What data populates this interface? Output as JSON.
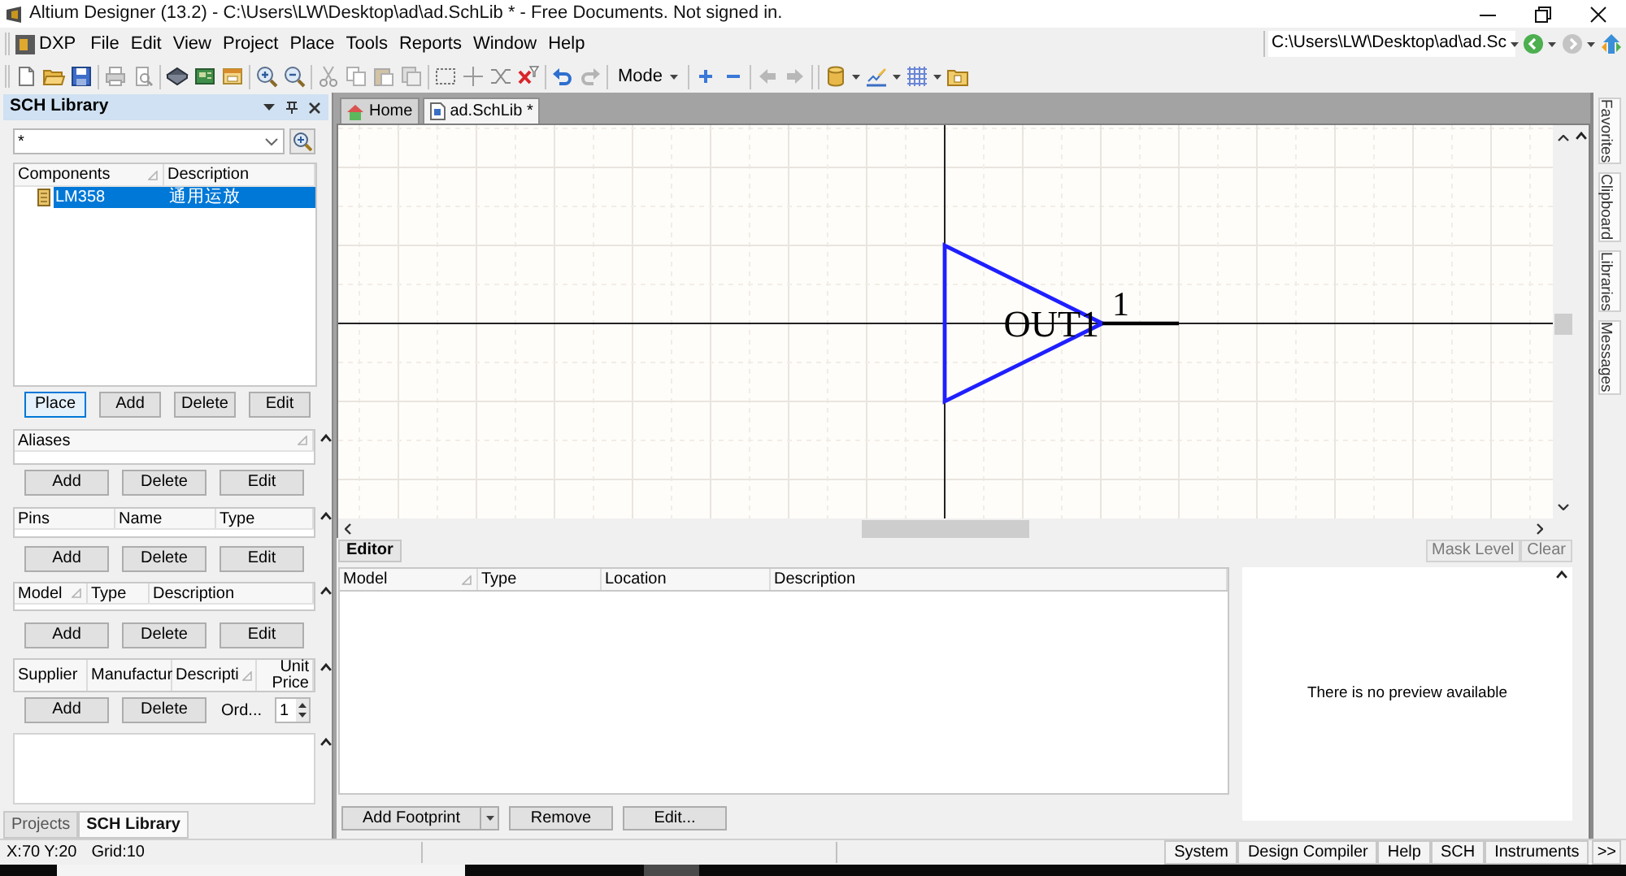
{
  "window": {
    "title": "Altium Designer (13.2) - C:\\Users\\LW\\Desktop\\ad\\ad.SchLib * - Free Documents. Not signed in."
  },
  "menu": {
    "app_button": "DXP",
    "items": [
      "File",
      "Edit",
      "View",
      "Project",
      "Place",
      "Tools",
      "Reports",
      "Window",
      "Help"
    ],
    "path": "C:\\Users\\LW\\Desktop\\ad\\ad.Sc"
  },
  "toolbar": {
    "mode": "Mode"
  },
  "left_panel": {
    "title": "SCH Library",
    "filter": {
      "value": "*"
    },
    "components": {
      "columns": [
        {
          "label": "Components",
          "sorted": true
        },
        {
          "label": "Description",
          "sorted": false
        }
      ],
      "rows": [
        {
          "name": "LM358",
          "description": "通用运放",
          "selected": true
        }
      ],
      "buttons": [
        {
          "label": "Place",
          "focused": true
        },
        {
          "label": "Add",
          "focused": false
        },
        {
          "label": "Delete",
          "focused": false
        },
        {
          "label": "Edit",
          "focused": false
        }
      ]
    },
    "aliases": {
      "columns": [
        {
          "label": "Aliases",
          "sorted": true
        }
      ],
      "buttons": [
        "Add",
        "Delete",
        "Edit"
      ]
    },
    "pins": {
      "columns": [
        {
          "label": "Pins",
          "sorted": false
        },
        {
          "label": "Name",
          "sorted": false
        },
        {
          "label": "Type",
          "sorted": false
        }
      ],
      "buttons": [
        "Add",
        "Delete",
        "Edit"
      ]
    },
    "models": {
      "columns": [
        {
          "label": "Model",
          "sorted": true
        },
        {
          "label": "Type",
          "sorted": false
        },
        {
          "label": "Description",
          "sorted": false
        }
      ],
      "buttons": [
        "Add",
        "Delete",
        "Edit"
      ]
    },
    "suppliers": {
      "columns": [
        {
          "label": "Supplier",
          "sorted": false
        },
        {
          "label": "Manufactur",
          "sorted": false
        },
        {
          "label": "Descripti",
          "sorted": true
        },
        {
          "label": "Unit Price",
          "sorted": false
        }
      ],
      "buttons": [
        "Add",
        "Delete"
      ],
      "order_label": "Ord...",
      "order_quantity": "1"
    },
    "tabs": [
      {
        "label": "Projects",
        "selected": false
      },
      {
        "label": "SCH Library",
        "selected": true
      }
    ]
  },
  "document_tabs": [
    {
      "label": "Home",
      "kind": "home",
      "selected": false
    },
    {
      "label": "ad.SchLib *",
      "kind": "document",
      "selected": true
    }
  ],
  "canvas": {
    "pin_name": "OUT1",
    "pin_number": "1"
  },
  "editor": {
    "tab": "Editor",
    "tools": [
      {
        "label": "Mask Level",
        "disabled": true
      },
      {
        "label": "Clear",
        "disabled": true
      }
    ],
    "columns": [
      {
        "label": "Model",
        "sorted": true
      },
      {
        "label": "Type",
        "sorted": false
      },
      {
        "label": "Location",
        "sorted": false
      },
      {
        "label": "Description",
        "sorted": false
      }
    ],
    "preview_message": "There is no preview available",
    "buttons": [
      {
        "label": "Add Footprint",
        "kind": "split"
      },
      {
        "label": "Remove",
        "kind": "plain"
      },
      {
        "label": "Edit...",
        "kind": "plain"
      }
    ]
  },
  "side_tabs": [
    "Favorites",
    "Clipboard",
    "Libraries",
    "Messages"
  ],
  "status_bar": {
    "position": "X:70 Y:20",
    "grid": "Grid:10",
    "buttons": [
      "System",
      "Design Compiler",
      "Help",
      "SCH",
      "Instruments",
      ">>"
    ]
  }
}
